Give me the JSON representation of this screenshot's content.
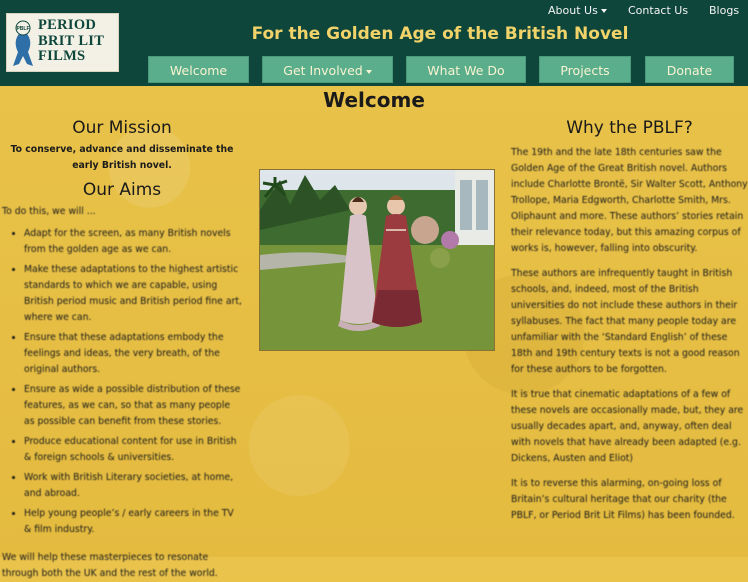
{
  "header": {
    "logo": {
      "text": "PERIOD\nBRIT LIT\nFILMS",
      "ribbon_text": "PBLF"
    },
    "site_title": "For the Golden Age of the British Novel",
    "top_links": {
      "about": "About Us",
      "contact": "Contact Us",
      "blogs": "Blogs"
    },
    "nav": {
      "welcome": "Welcome",
      "get_involved": "Get Involved",
      "what_we_do": "What We Do",
      "projects": "Projects",
      "donate": "Donate"
    }
  },
  "page_title": "Welcome",
  "left": {
    "mission_heading": "Our Mission",
    "mission_text": "To conserve, advance and disseminate the early British novel.",
    "aims_heading": "Our Aims",
    "aims_intro": "To do this, we will ...",
    "aims": [
      "Adapt for the screen, as many British novels from the golden age as we can.",
      "Make these adaptations to the highest artistic standards to which we are capable, using British period music and British period fine art, where we can.",
      "Ensure that these adaptations embody the feelings and ideas, the very breath, of the original authors.",
      "Ensure as wide a possible distribution of these features, as we can, so that as many people as possible can benefit from these stories.",
      "Produce educational content for use in British & foreign schools & universities.",
      "Work with British Literary societies, at home, and abroad.",
      "Help young people’s / early careers in the TV & film industry."
    ],
    "closing": "We will help these masterpieces to resonate through both the UK and the rest of the world."
  },
  "right": {
    "heading": "Why the PBLF?",
    "p1": "The 19th and the late 18th centuries saw the Golden Age of the Great British novel. Authors include Charlotte Brontë, Sir Walter Scott, Anthony Trollope, Maria Edgworth, Charlotte Smith, Mrs. Oliphaunt and more. These authors’ stories retain their relevance today, but this amazing corpus of works is, however, falling into obscurity.",
    "p2": "These authors are infrequently taught in British schools, and, indeed, most of the British universities do not include these authors in their syllabuses. The fact that many people today are unfamiliar with the ‘Standard English’ of these 18th and 19th century texts is not a good reason for these authors to be forgotten.",
    "p3": "It is true that cinematic adaptations of a few of these novels are occasionally made, but, they are usually decades apart, and, anyway, often deal with novels that have already been adapted (e.g. Dickens, Austen and Eliot)",
    "p4": "It is to reverse this alarming, on-going loss of Britain’s cultural heritage that our charity (the PBLF, or Period Brit Lit Films) has been founded."
  },
  "colors": {
    "header": "#0e463b",
    "nav_button": "#5aae8b",
    "title_gold": "#f1d36a",
    "background": "#e8c046"
  }
}
